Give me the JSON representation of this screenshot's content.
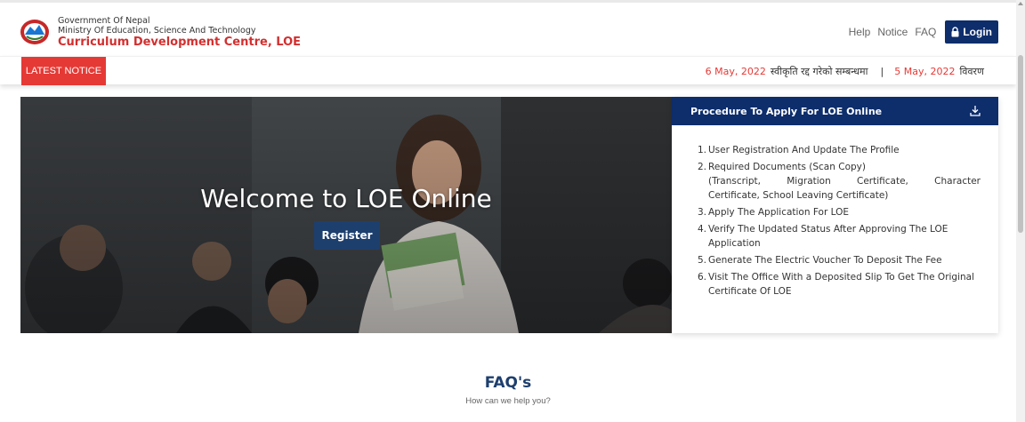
{
  "header": {
    "gov_line1": "Government Of Nepal",
    "gov_line2": "Ministry Of Education, Science And Technology",
    "org_title": "Curriculum Development Centre, LOE",
    "nav": {
      "help": "Help",
      "notice": "Notice",
      "faq": "FAQ",
      "login": "Login"
    }
  },
  "notice_bar": {
    "label": "LATEST NOTICE",
    "items": [
      {
        "date": "6 May, 2022",
        "text": "स्वीकृति रद्द गरेको सम्बन्धमा"
      },
      {
        "date": "5 May, 2022",
        "text": "विवरण"
      }
    ],
    "separator": "|"
  },
  "hero": {
    "title": "Welcome to LOE Online",
    "register": "Register"
  },
  "procedure": {
    "title": "Procedure To Apply For LOE Online",
    "steps": [
      {
        "num": "1.",
        "text": "User Registration And Update The Profile"
      },
      {
        "num": "2.",
        "text": "Required Documents (Scan Copy)",
        "sub1": "(Transcript, Migration Certificate, Character",
        "sub2": "Certificate, School Leaving Certificate)"
      },
      {
        "num": "3.",
        "text": "Apply The Application For LOE"
      },
      {
        "num": "4.",
        "text": "Verify The Updated Status After Approving The LOE Application"
      },
      {
        "num": "5.",
        "text": "Generate The Electric Voucher To Deposit The Fee"
      },
      {
        "num": "6.",
        "text": "Visit The Office With a Deposited Slip To Get The Original Certificate Of LOE"
      }
    ]
  },
  "faq": {
    "title": "FAQ's",
    "subtitle": "How can we help you?"
  },
  "colors": {
    "brand_navy": "#0d2d6b",
    "accent_red": "#e53935",
    "register_blue": "#1d3f6e"
  }
}
